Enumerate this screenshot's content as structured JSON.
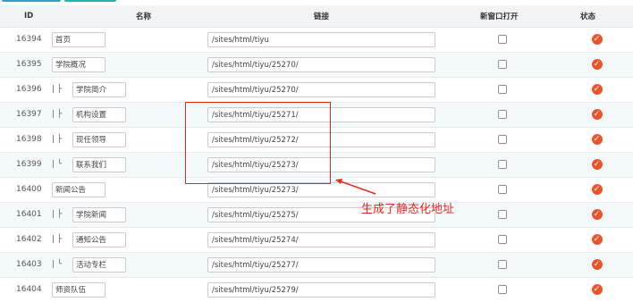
{
  "columns": {
    "id": "ID",
    "name": "名称",
    "link": "链接",
    "new_window": "新窗口打开",
    "status": "状态"
  },
  "rows": [
    {
      "id": "16394",
      "prefix": "",
      "name": "首页",
      "link": "/sites/html/tiyu"
    },
    {
      "id": "16395",
      "prefix": "",
      "name": "学院概况",
      "link": "/sites/html/tiyu/25270/"
    },
    {
      "id": "16396",
      "prefix": "| ├",
      "name": "学院简介",
      "link": "/sites/html/tiyu/25270/"
    },
    {
      "id": "16397",
      "prefix": "| ├",
      "name": "机构设置",
      "link": "/sites/html/tiyu/25271/"
    },
    {
      "id": "16398",
      "prefix": "| ├",
      "name": "现任领导",
      "link": "/sites/html/tiyu/25272/"
    },
    {
      "id": "16399",
      "prefix": "| └",
      "name": "联系我们",
      "link": "/sites/html/tiyu/25273/"
    },
    {
      "id": "16400",
      "prefix": "",
      "name": "新闻公告",
      "link": "/sites/html/tiyu/25273/"
    },
    {
      "id": "16401",
      "prefix": "| ├",
      "name": "学院新闻",
      "link": "/sites/html/tiyu/25275/"
    },
    {
      "id": "16402",
      "prefix": "| ├",
      "name": "通知公告",
      "link": "/sites/html/tiyu/25274/"
    },
    {
      "id": "16403",
      "prefix": "| └",
      "name": "活动专栏",
      "link": "/sites/html/tiyu/25277/"
    },
    {
      "id": "16404",
      "prefix": "",
      "name": "师资队伍",
      "link": "/sites/html/tiyu/25279/"
    }
  ],
  "annotation": {
    "text": "生成了静态化地址"
  },
  "status_glyph": "✓",
  "colors": {
    "accent_red": "#e8281f",
    "status_orange": "#f0542d"
  }
}
